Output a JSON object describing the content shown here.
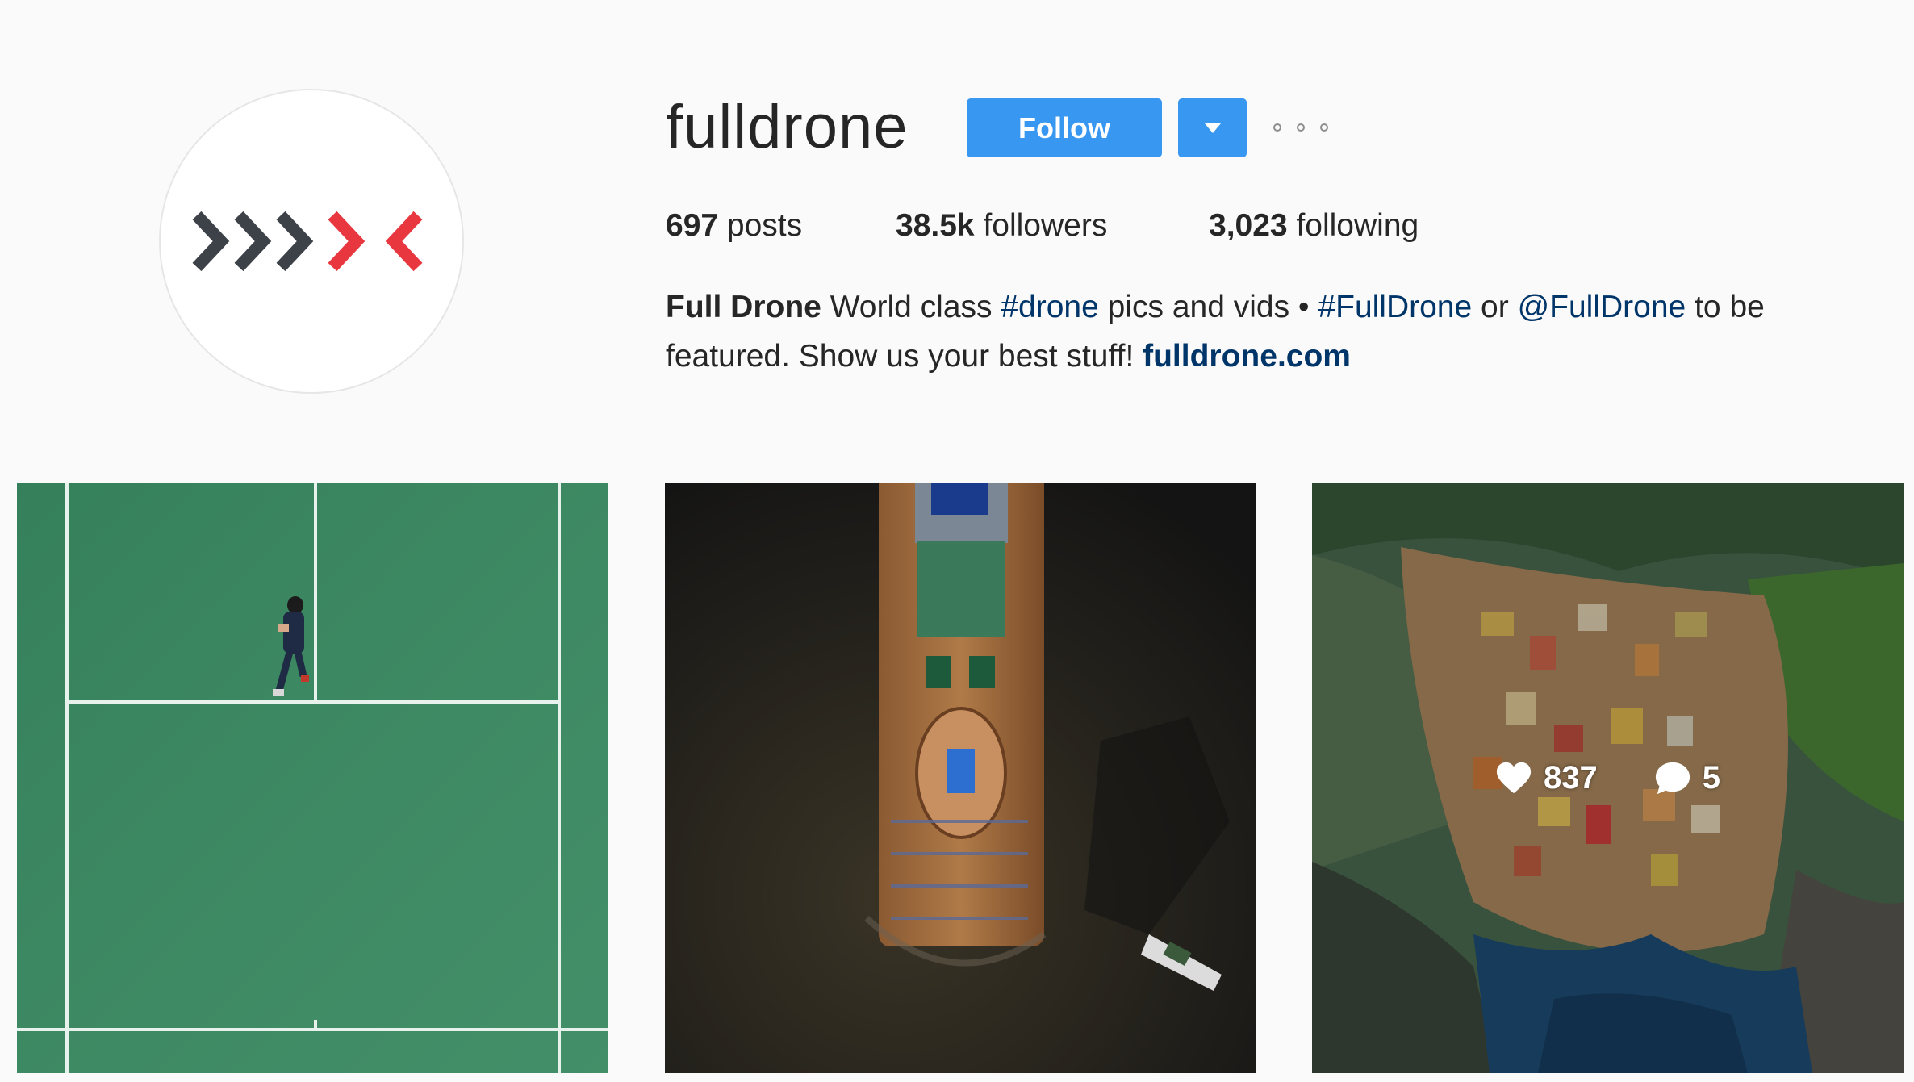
{
  "profile": {
    "username": "fulldrone",
    "follow_label": "Follow",
    "stats": {
      "posts_count": "697",
      "posts_label": "posts",
      "followers_count": "38.5k",
      "followers_label": "followers",
      "following_count": "3,023",
      "following_label": "following"
    },
    "bio": {
      "full_name": "Full Drone",
      "text_1": "World class",
      "hashtag_1": "#drone",
      "text_2": "pics and vids •",
      "hashtag_2": "#FullDrone",
      "text_3": "or",
      "mention": "@FullDrone",
      "text_4": "to be featured. Show us your best stuff!",
      "website": "fulldrone.com"
    }
  },
  "posts": [
    {
      "description": "aerial tennis court",
      "color": "#3e8a63"
    },
    {
      "description": "aerial cruise ship",
      "color": "#2a2620"
    },
    {
      "description": "aerial coastal village",
      "color": "#4d6e52",
      "likes": "837",
      "comments": "5"
    }
  ],
  "colors": {
    "accent": "#3897f0",
    "link": "#003569",
    "logo_dark": "#3d4148",
    "logo_red": "#e8373e"
  }
}
